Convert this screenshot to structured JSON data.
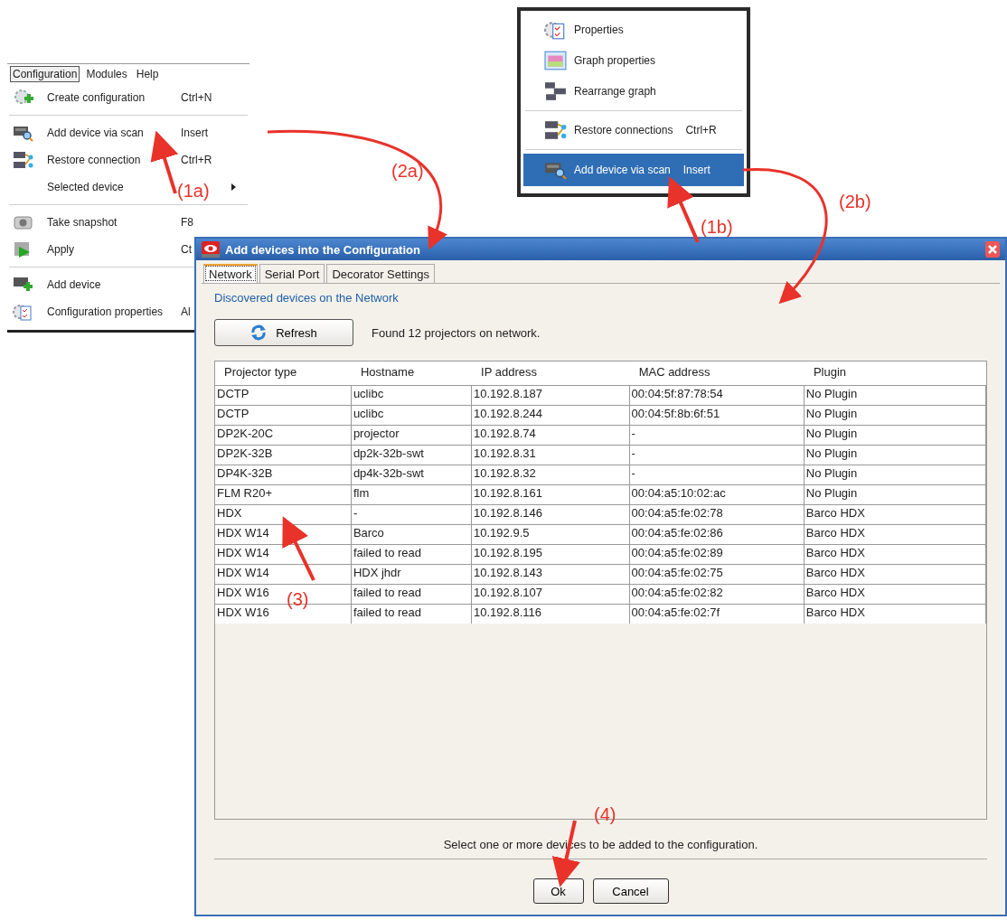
{
  "main_menu": {
    "menu_bar": [
      {
        "label": "Configuration",
        "selected": true
      },
      {
        "label": "Modules",
        "selected": false
      },
      {
        "label": "Help",
        "selected": false
      }
    ],
    "groups": [
      [
        {
          "label": "Create configuration",
          "shortcut": "Ctrl+N"
        }
      ],
      [
        {
          "label": "Add device via scan",
          "shortcut": "Insert"
        },
        {
          "label": "Restore connection",
          "shortcut": "Ctrl+R"
        },
        {
          "label": "Selected device",
          "submenu": true
        }
      ],
      [
        {
          "label": "Take snapshot",
          "shortcut": "F8"
        },
        {
          "label": "Apply",
          "shortcut": "Ct"
        }
      ],
      [
        {
          "label": "Add device"
        },
        {
          "label": "Configuration properties",
          "shortcut": "Al"
        }
      ]
    ]
  },
  "context_menu": {
    "groups": [
      [
        {
          "label": "Properties",
          "selected": false
        },
        {
          "label": "Graph properties",
          "selected": false
        },
        {
          "label": "Rearrange graph",
          "selected": false
        }
      ],
      [
        {
          "label": "Restore connections",
          "shortcut": "Ctrl+R",
          "selected": false
        }
      ],
      [
        {
          "label": "Add device via scan",
          "shortcut": "Insert",
          "selected": true
        }
      ]
    ]
  },
  "dialog": {
    "title": "Add devices into the Configuration",
    "tabs": [
      {
        "label": "Network",
        "selected": true
      },
      {
        "label": "Serial Port",
        "selected": false
      },
      {
        "label": "Decorator Settings",
        "selected": false
      }
    ],
    "section_title": "Discovered devices on the Network",
    "refresh_button": "Refresh",
    "status": "Found 12 projectors on network.",
    "table": {
      "columns": [
        "Projector type",
        "Hostname",
        "IP address",
        "MAC address",
        "Plugin"
      ],
      "rows": [
        [
          "DCTP",
          "uclibc",
          "10.192.8.187",
          "00:04:5f:87:78:54",
          "No Plugin"
        ],
        [
          "DCTP",
          "uclibc",
          "10.192.8.244",
          "00:04:5f:8b:6f:51",
          "No Plugin"
        ],
        [
          "DP2K-20C",
          "projector",
          "10.192.8.74",
          "-",
          "No Plugin"
        ],
        [
          "DP2K-32B",
          "dp2k-32b-swt",
          "10.192.8.31",
          "-",
          "No Plugin"
        ],
        [
          "DP4K-32B",
          "dp4k-32b-swt",
          "10.192.8.32",
          "-",
          "No Plugin"
        ],
        [
          "FLM R20+",
          "flm",
          "10.192.8.161",
          "00:04:a5:10:02:ac",
          "No Plugin"
        ],
        [
          "HDX",
          "-",
          "10.192.8.146",
          "00:04:a5:fe:02:78",
          "Barco HDX"
        ],
        [
          "HDX W14",
          "Barco",
          "10.192.9.5",
          "00:04:a5:fe:02:86",
          "Barco HDX"
        ],
        [
          "HDX W14",
          "failed to read",
          "10.192.8.195",
          "00:04:a5:fe:02:89",
          "Barco HDX"
        ],
        [
          "HDX W14",
          "HDX jhdr",
          "10.192.8.143",
          "00:04:a5:fe:02:75",
          "Barco HDX"
        ],
        [
          "HDX W16",
          "failed to read",
          "10.192.8.107",
          "00:04:a5:fe:02:82",
          "Barco HDX"
        ],
        [
          "HDX W16",
          "failed to read",
          "10.192.8.116",
          "00:04:a5:fe:02:7f",
          "Barco HDX"
        ]
      ]
    },
    "hint": "Select one or more devices to be added to the configuration.",
    "buttons": [
      "Ok",
      "Cancel"
    ]
  },
  "callouts": [
    "(1a)",
    "(1b)",
    "(2a)",
    "(2b)",
    "(3)",
    "(4)"
  ]
}
